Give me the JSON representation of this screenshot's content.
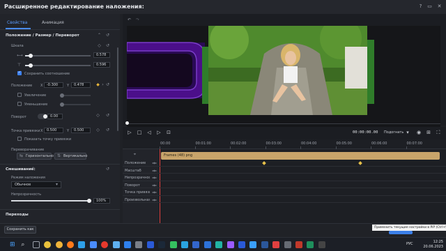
{
  "window": {
    "title": "Расширенное редактирование наложения:",
    "icons": [
      "help-icon",
      "minimize-icon",
      "close-icon"
    ]
  },
  "tabs": [
    {
      "label": "Свойства",
      "active": true
    },
    {
      "label": "Анимация",
      "active": false
    }
  ],
  "properties": {
    "section_title": "Положение / Размер / Переворот",
    "scale": {
      "label": "Шкала",
      "width_value": "0.578",
      "height_value": "0.596",
      "lock_label": "Сохранить соотношение",
      "lock_checked": true
    },
    "position": {
      "label": "Положение",
      "x_label": "X",
      "x_value": "-0.300",
      "y_label": "Y",
      "y_value": "0.478",
      "increase_label": "Увеличение",
      "decrease_label": "Уменьшение"
    },
    "rotation": {
      "label": "Поворот",
      "value": "0.00"
    },
    "anchor": {
      "label": "Точка привязки",
      "x_label": "X",
      "x_value": "0.500",
      "y_label": "Y",
      "y_value": "0.500",
      "show_label": "Показать точку привязки",
      "show_checked": false
    },
    "flip": {
      "label": "Переворачивание",
      "horizontal_label": "Горизонтально",
      "vertical_label": "Вертикально"
    },
    "blending": {
      "section_title": "Смешивание:",
      "mode_label": "Режим наложения",
      "mode_value": "Обычное",
      "opacity_label": "Непрозрачность",
      "opacity_value": "100%",
      "opacity_fraction": 1.0
    },
    "transitions_title": "Переходы"
  },
  "footer": {
    "save_as_label": "Сохранить как"
  },
  "transport": {
    "timecode": "00:00:00.00",
    "fit_label": "Подогнать"
  },
  "timeline": {
    "ruler_labels": [
      "00:00",
      "00:01:00",
      "00:02:00",
      "00:03:00",
      "00:04:00",
      "00:05:00",
      "00:06:00",
      "00:07:00"
    ],
    "clip_name": "Frames (48) png",
    "tracks": [
      "Положение",
      "Масштаб",
      "Непрозрачность...",
      "Поворот",
      "Точка привязк...",
      "Произвольная..."
    ],
    "keyframe_positions": [
      0.365,
      0.71
    ]
  },
  "tooltip": {
    "text": "Применить текущие настройки в PiP (Ctrl+S)"
  },
  "taskbar": {
    "language": "РУС",
    "time": "12:25",
    "date": "20.06.2023",
    "icons": [
      "windows-icon",
      "search-icon",
      "taskview-icon",
      "chrome-icon",
      "chrome-icon",
      "firefox-icon",
      "edge-icon",
      "mail-icon",
      "yandex-icon",
      "gallery-icon",
      "photos-icon",
      "calculator-icon",
      "photoshop-icon",
      "steam-icon",
      "whatsapp-icon",
      "telegram-icon",
      "security-icon",
      "mail-icon",
      "filmora-icon",
      "premiere-icon",
      "photoshop-icon",
      "browser-icon",
      "word-icon",
      "app-icon",
      "app-icon",
      "app-icon",
      "app-icon",
      "app-icon"
    ]
  },
  "colors": {
    "accent": "#3e82f7",
    "clip": "#c8a46a",
    "playhead": "#e0403f",
    "keyframe": "#e6c04a",
    "purple": "#4b0f8a"
  }
}
